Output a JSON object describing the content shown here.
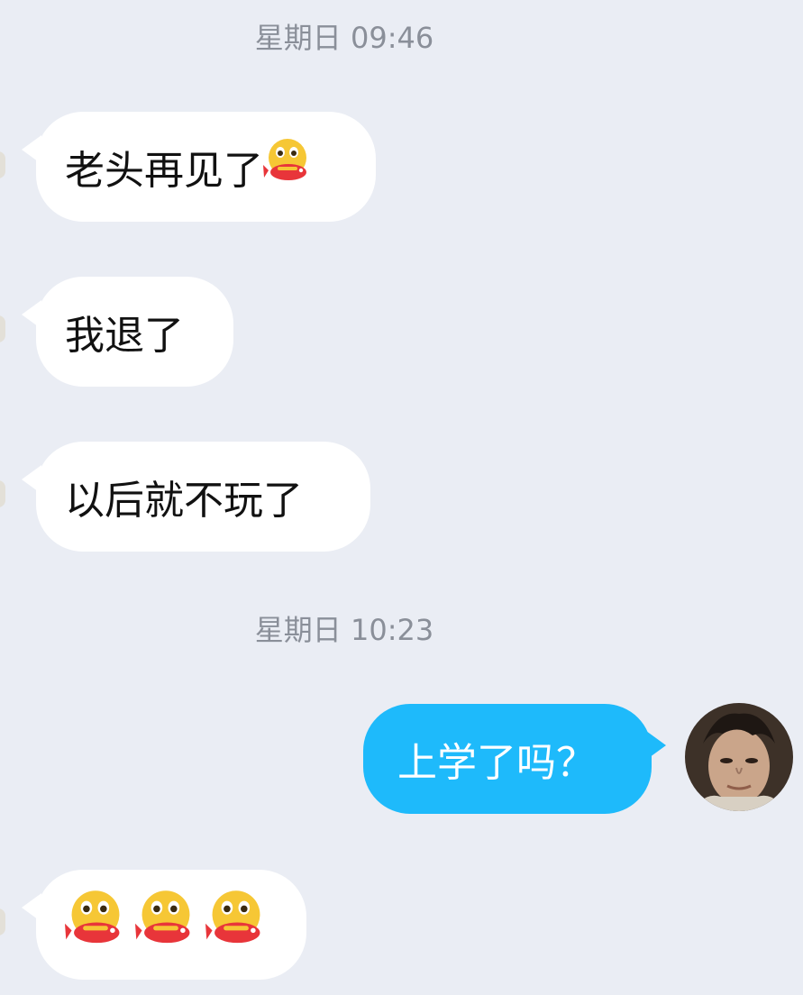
{
  "timestamps": [
    {
      "text": "星期日 09:46"
    },
    {
      "text": "星期日 10:23"
    }
  ],
  "messages": [
    {
      "text": "老头再见了",
      "emoji": "fish-eating-face-emoji",
      "sender": "other"
    },
    {
      "text": "我退了",
      "sender": "other"
    },
    {
      "text": "以后就不玩了",
      "sender": "other"
    },
    {
      "text": "上学了吗？",
      "sender": "me"
    },
    {
      "text": "",
      "emoji": "fish-eating-face-emoji",
      "emoji_count": 3,
      "sender": "other"
    }
  ],
  "colors": {
    "background": "#eaedf4",
    "incoming_bubble": "#ffffff",
    "outgoing_bubble": "#1ebafb",
    "timestamp_text": "#8a8f99"
  }
}
